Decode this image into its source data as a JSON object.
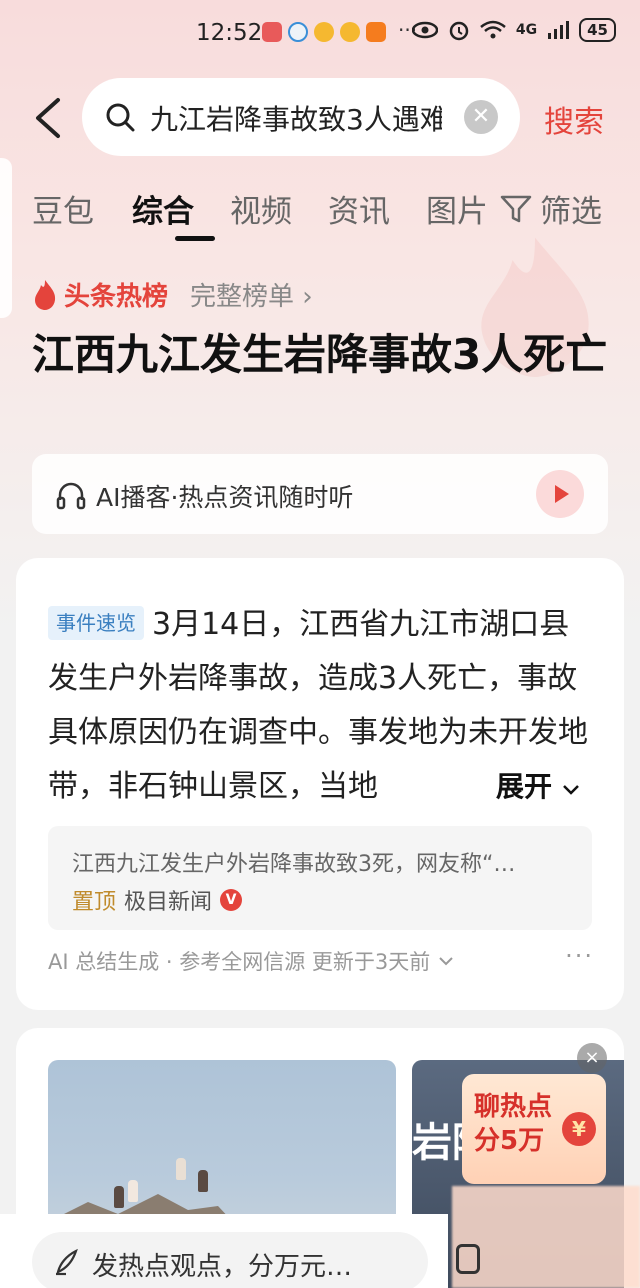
{
  "status_bar": {
    "time": "12:52",
    "dots": "···",
    "network": "4G",
    "battery": "45"
  },
  "search": {
    "query": "九江岩降事故致3人遇难",
    "clear_icon": "clear-icon",
    "button": "搜索"
  },
  "tabs": [
    {
      "label": "豆包"
    },
    {
      "label": "综合"
    },
    {
      "label": "视频"
    },
    {
      "label": "资讯"
    },
    {
      "label": "图片"
    }
  ],
  "active_tab": 1,
  "filter_label": "筛选",
  "hot_list": {
    "label": "头条热榜",
    "link": "完整榜单 ›",
    "title": "江西九江发生岩降事故3人死亡"
  },
  "ai_podcast": {
    "text": "AI播客·热点资讯随时听"
  },
  "summary_card": {
    "badge": "事件速览",
    "text": "3月14日，江西省九江市湖口县发生户外岩降事故，造成3人死亡，事故具体原因仍在调查中。事发地为未开发地带，非石钟山景区，当地",
    "expand": "展开",
    "source_title": "江西九江发生户外岩降事故致3死，网友称“…",
    "pin_tag": "置顶",
    "source_name": "极目新闻",
    "verified": "V",
    "footer": "AI 总结生成 · 参考全网信源 更新于3天前",
    "more": "···"
  },
  "image_card": {
    "photo2_text": "岩降",
    "promo_line1": "聊热点",
    "promo_line2": "分5万",
    "promo_coin": "¥",
    "close": "×"
  },
  "bottom_bar": {
    "comment_placeholder": "发热点观点，分万元…"
  },
  "colors": {
    "accent": "#e4443c",
    "badge_bg": "#e6f1fb",
    "badge_text": "#3a7fc0",
    "pin": "#c08b2c"
  }
}
